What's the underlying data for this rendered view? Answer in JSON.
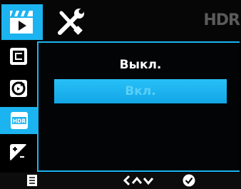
{
  "header": {
    "tabs": [
      {
        "name": "video",
        "icon": "video-camera-icon",
        "active": true
      },
      {
        "name": "settings",
        "icon": "tools-icon",
        "active": false
      }
    ],
    "title": "HDR"
  },
  "sidebar": {
    "items": [
      {
        "icon": "photo-stack-icon",
        "active": false
      },
      {
        "icon": "loop-record-icon",
        "active": false
      },
      {
        "icon": "hdr-icon",
        "label": "HDR",
        "active": true
      },
      {
        "icon": "exposure-icon",
        "active": false
      }
    ]
  },
  "options": [
    {
      "label": "Выкл.",
      "selected": false
    },
    {
      "label": "Вкл.",
      "selected": true
    }
  ],
  "footer": {
    "left_icon": "menu-icon",
    "nav_icon": "back-up-down-icon",
    "ok_icon": "checkmark-icon"
  },
  "colors": {
    "accent": "#1cb4f0",
    "background": "#000000",
    "text": "#ffffff"
  }
}
